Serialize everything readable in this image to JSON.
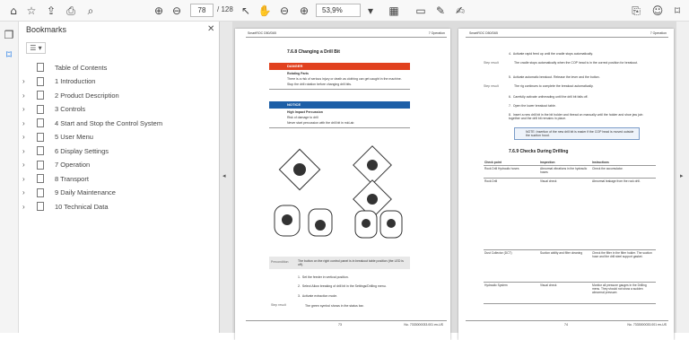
{
  "toolbar": {
    "current_page": "78",
    "page_total": "/ 128",
    "zoom": "53,9%"
  },
  "bookmarks": {
    "title": "Bookmarks",
    "items": [
      {
        "label": "Table of Contents",
        "expandable": false
      },
      {
        "label": "1 Introduction",
        "expandable": true
      },
      {
        "label": "2 Product Description",
        "expandable": true
      },
      {
        "label": "3 Controls",
        "expandable": true
      },
      {
        "label": "4 Start and Stop the Control System",
        "expandable": true
      },
      {
        "label": "5 User Menu",
        "expandable": true
      },
      {
        "label": "6 Display Settings",
        "expandable": true
      },
      {
        "label": "7 Operation",
        "expandable": true
      },
      {
        "label": "8 Transport",
        "expandable": true
      },
      {
        "label": "9 Daily Maintenance",
        "expandable": true
      },
      {
        "label": "10 Technical Data",
        "expandable": true
      }
    ]
  },
  "page_left": {
    "header_left": "SmartROC D50/D65",
    "header_right": "7 Operation",
    "section": "7.6.8 Changing a Drill Bit",
    "danger_label": "DANGER",
    "danger_title": "Rotating Parts",
    "danger_line1": "There is a risk of serious injury or death as clothing can get caught in the machine.",
    "danger_line2": "Stop the drill rotation before changing drill bits.",
    "notice_label": "NOTICE",
    "notice_title": "High Impact Percussion",
    "notice_line1": "Risk of damage to drill",
    "notice_line2": "Never start percussion with the drill bit in mid-air.",
    "precondition_label": "Precondition",
    "precondition_text": "The button on the right control panel is in breakout table position (the LED is off).",
    "step1": "Set the feeder in vertical position.",
    "step2": "Select Allow breaking of drill bit in the Settings/Drilling menu.",
    "step3": "Activate extraction mode.",
    "step_result_label": "Step result",
    "step_result_text": "The green symbol shows in the status bar.",
    "footer_page": "73",
    "footer_doc": "No. 7333000033.001 en-US"
  },
  "page_right": {
    "header_left": "SmartROC D50/D65",
    "header_right": "7 Operation",
    "step4": "Activate rapid feed up until the cradle stops automatically.",
    "step4_result": "The cradle stops automatically when the COP head is in the correct position for breakout.",
    "step5": "Activate automatic breakout. Release the lever and the button.",
    "step5_result": "The rig continues to complete the breakout automatically.",
    "step6": "Carefully activate unthreading until the drill bit falls off.",
    "step7": "Open the lower breakout table.",
    "step8": "Insert a new drill bit in the bit holder and thread on manually until the holder and shoe jaw join together and the drill bit remains in place.",
    "note_text": "NOTE: Insertion of the new drill bit is easier if the COP head is moved outside the suction hood.",
    "section": "7.6.9 Checks During Drilling",
    "table_headers": [
      "Check point",
      "Inspection",
      "Instructions"
    ],
    "table_rows": [
      [
        "Rock Drill Hydraulic hoses",
        "Abnormal vibrations in the hydraulic hoses",
        "Check the accumulator."
      ],
      [
        "Rock Drill",
        "Visual check",
        "Abnormal leakage from the rock drill."
      ],
      [
        "Dust Collector (DCT)",
        "Suction ability and filter cleaning",
        "Check the filter in the filter holder. The suction hose and the drill steel support gasket."
      ],
      [
        "Hydraulic System",
        "Visual check",
        "Monitor all pressure gauges in the Drilling menu. They should not show a sudden abnormal pressure."
      ]
    ],
    "footer_page": "74",
    "footer_doc": "No. 7333000033.001 en-US"
  }
}
